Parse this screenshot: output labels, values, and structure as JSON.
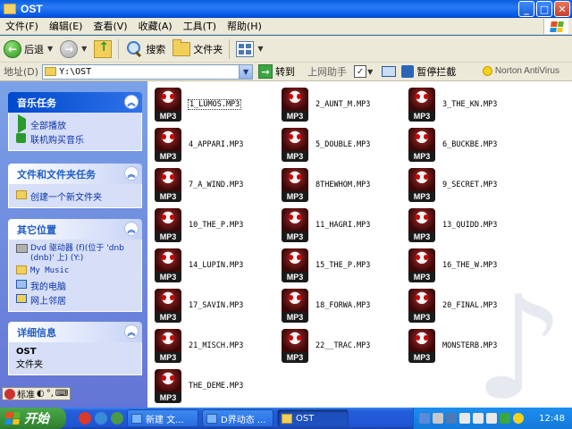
{
  "window": {
    "title": "OST",
    "controls": [
      "minimize",
      "maximize",
      "close"
    ]
  },
  "menu": [
    "文件(F)",
    "编辑(E)",
    "查看(V)",
    "收藏(A)",
    "工具(T)",
    "帮助(H)"
  ],
  "toolbar": {
    "back_label": "后退",
    "search_label": "搜索",
    "folders_label": "文件夹"
  },
  "address": {
    "label": "地址(D)",
    "value": "Y:\\OST",
    "go_label": "转到",
    "helper_label": "上网助手",
    "block_label": "暂停拦截",
    "norton_label": "Norton AntiVirus"
  },
  "taskpane": {
    "music_tasks": {
      "title": "音乐任务",
      "items": [
        "全部播放",
        "联机购买音乐"
      ]
    },
    "file_tasks": {
      "title": "文件和文件夹任务",
      "items": [
        "创建一个新文件夹"
      ]
    },
    "other_places": {
      "title": "其它位置",
      "drive": "Dvd 驱动器 (f)(位于 'dnb (dnb)' 上) (Y:)",
      "items": [
        "My Music",
        "我的电脑",
        "网上邻居"
      ]
    },
    "details": {
      "title": "详细信息",
      "name": "OST",
      "type": "文件夹"
    }
  },
  "files": [
    "1_LUMOS.MP3",
    "2_AUNT_M.MP3",
    "3_THE_KN.MP3",
    "4_APPARI.MP3",
    "5_DOUBLE.MP3",
    "6_BUCKBE.MP3",
    "7_A_WIND.MP3",
    "8THEWHOM.MP3",
    "9_SECRET.MP3",
    "10_THE_P.MP3",
    "11_HAGRI.MP3",
    "13_QUIDD.MP3",
    "14_LUPIN.MP3",
    "15_THE_P.MP3",
    "16_THE_W.MP3",
    "17_SAVIN.MP3",
    "18_FORWA.MP3",
    "20_FINAL.MP3",
    "21_MISCH.MP3",
    "22__TRAC.MP3",
    "MONSTERB.MP3",
    "THE_DEME.MP3"
  ],
  "file_icon_label": "MP3",
  "langbar": {
    "label": "标准"
  },
  "taskbar": {
    "start_label": "开始",
    "buttons": [
      "新建 文...",
      "D界动态 ...",
      "OST"
    ],
    "clock": "12:48"
  },
  "colors": {
    "titlebar": "#0054e3",
    "taskpane_bg": "#6375d6",
    "taskbar": "#245edb",
    "start_button": "#3c953c"
  }
}
